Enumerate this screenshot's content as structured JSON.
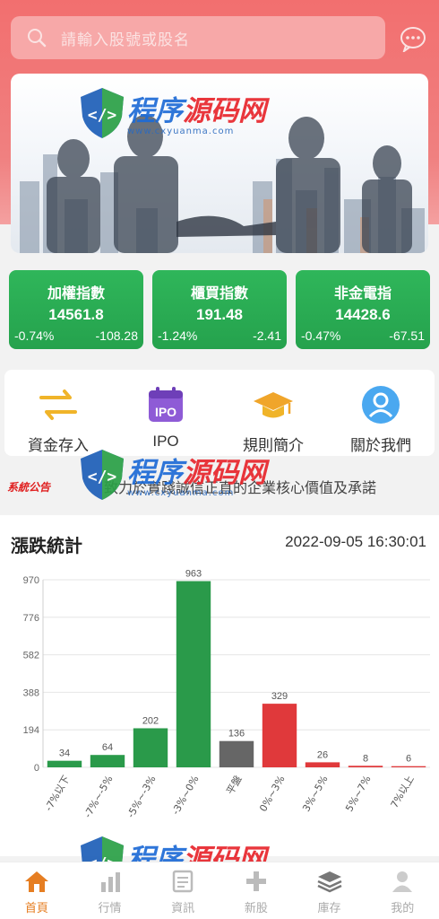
{
  "search": {
    "placeholder": "請輸入股號或股名"
  },
  "watermark": {
    "name_part1": "程序",
    "name_part2": "源码网",
    "url": "www.cxyuanma.com"
  },
  "indices": [
    {
      "name": "加權指數",
      "value": "14561.8",
      "pct": "-0.74%",
      "change": "-108.28"
    },
    {
      "name": "櫃買指數",
      "value": "191.48",
      "pct": "-1.24%",
      "change": "-2.41"
    },
    {
      "name": "非金電指",
      "value": "14428.6",
      "pct": "-0.47%",
      "change": "-67.51"
    }
  ],
  "quick_actions": [
    {
      "label": "資金存入",
      "icon": "transfer-arrows-icon"
    },
    {
      "label": "IPO",
      "icon": "ipo-calendar-icon"
    },
    {
      "label": "規則簡介",
      "icon": "graduation-cap-icon"
    },
    {
      "label": "關於我們",
      "icon": "user-circle-icon"
    }
  ],
  "notice": {
    "tag": "系統公告",
    "text": "致力於實踐誠信正直的企業核心價值及承諾"
  },
  "stats": {
    "title": "漲跌統計",
    "timestamp": "2022-09-05 16:30:01"
  },
  "chart_data": {
    "type": "bar",
    "categories": [
      "-7%以下",
      "-7%~-5%",
      "-5%~-3%",
      "-3%~0%",
      "平盤",
      "0%~3%",
      "3%~5%",
      "5%~7%",
      "7%以上"
    ],
    "values": [
      34,
      64,
      202,
      963,
      136,
      329,
      26,
      8,
      6
    ],
    "colors": [
      "#2a9a4a",
      "#2a9a4a",
      "#2a9a4a",
      "#2a9a4a",
      "#666666",
      "#e0393b",
      "#e0393b",
      "#e0393b",
      "#e0393b"
    ],
    "y_ticks": [
      0,
      194,
      388,
      582,
      776,
      970
    ],
    "ylim": [
      0,
      970
    ],
    "grid": true
  },
  "tabs": [
    {
      "label": "首頁",
      "icon": "home-icon",
      "active": true
    },
    {
      "label": "行情",
      "icon": "chart-icon",
      "active": false
    },
    {
      "label": "資訊",
      "icon": "news-icon",
      "active": false
    },
    {
      "label": "新股",
      "icon": "plus-icon",
      "active": false
    },
    {
      "label": "庫存",
      "icon": "layers-icon",
      "active": false
    },
    {
      "label": "我的",
      "icon": "user-icon",
      "active": false
    }
  ],
  "colors": {
    "accent": "#f26f6f",
    "up": "#e0393b",
    "down": "#2a9a4a",
    "active_tab": "#e67e22"
  }
}
